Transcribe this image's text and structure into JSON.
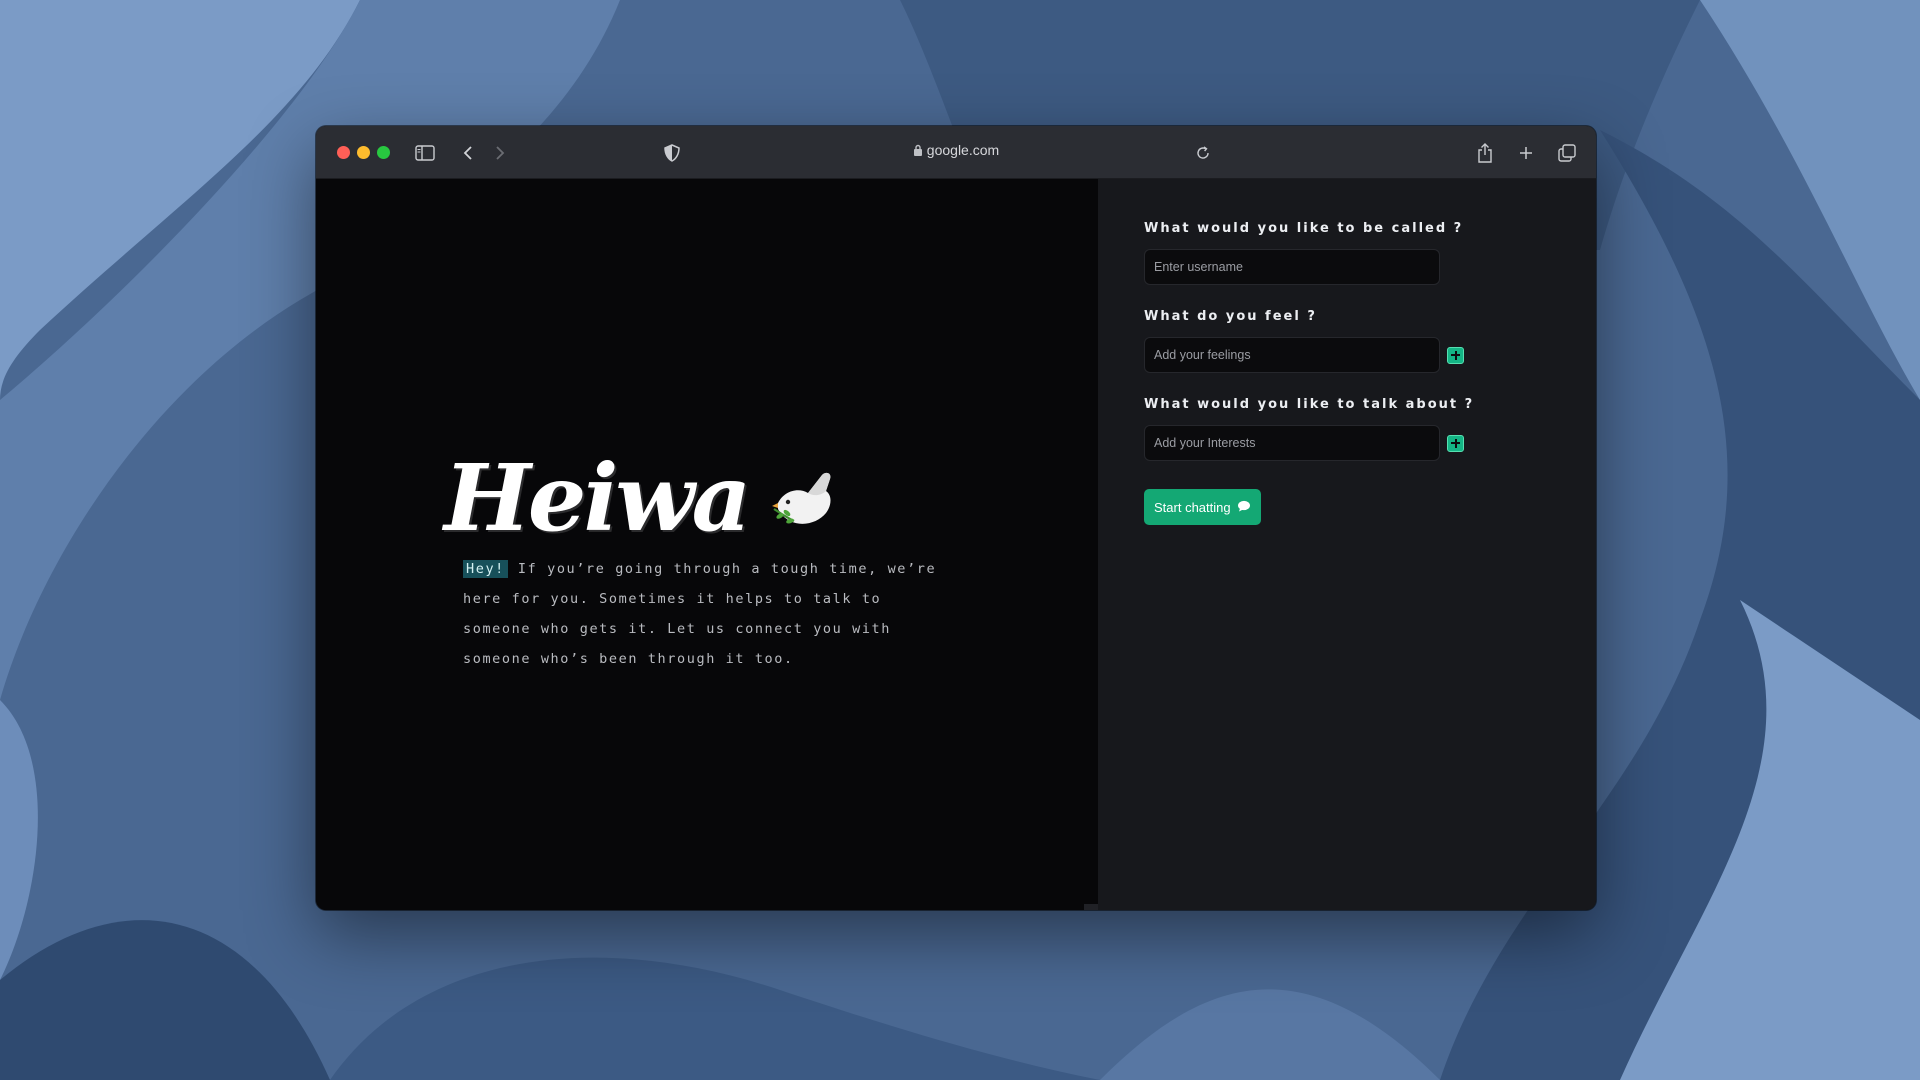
{
  "browser": {
    "url": "google.com",
    "icons": [
      "sidebar-icon",
      "back-icon",
      "forward-icon",
      "shield-icon",
      "lock-icon",
      "reload-icon",
      "share-icon",
      "new-tab-icon",
      "tabs-overview-icon"
    ]
  },
  "hero": {
    "logo_text": "Heiwa",
    "logo_icon": "dove-icon",
    "highlight": "Hey!",
    "description": "If you’re going through a tough time, we’re here for you. Sometimes it helps to talk to someone who gets it. Let us connect you with someone who’s been through it too."
  },
  "form": {
    "name_question": "What would you like to be called ?",
    "name_placeholder": "Enter username",
    "feel_question": "What do you feel ?",
    "feel_placeholder": "Add your feelings",
    "talk_question": "What would you like to talk about ?",
    "talk_placeholder": "Add your Interests",
    "start_label": "Start chatting",
    "start_icon": "chat-bubble-icon"
  },
  "colors": {
    "accent": "#14a874",
    "highlight_bg": "#17505a",
    "left_panel": "#070709",
    "right_panel": "#17181c"
  }
}
